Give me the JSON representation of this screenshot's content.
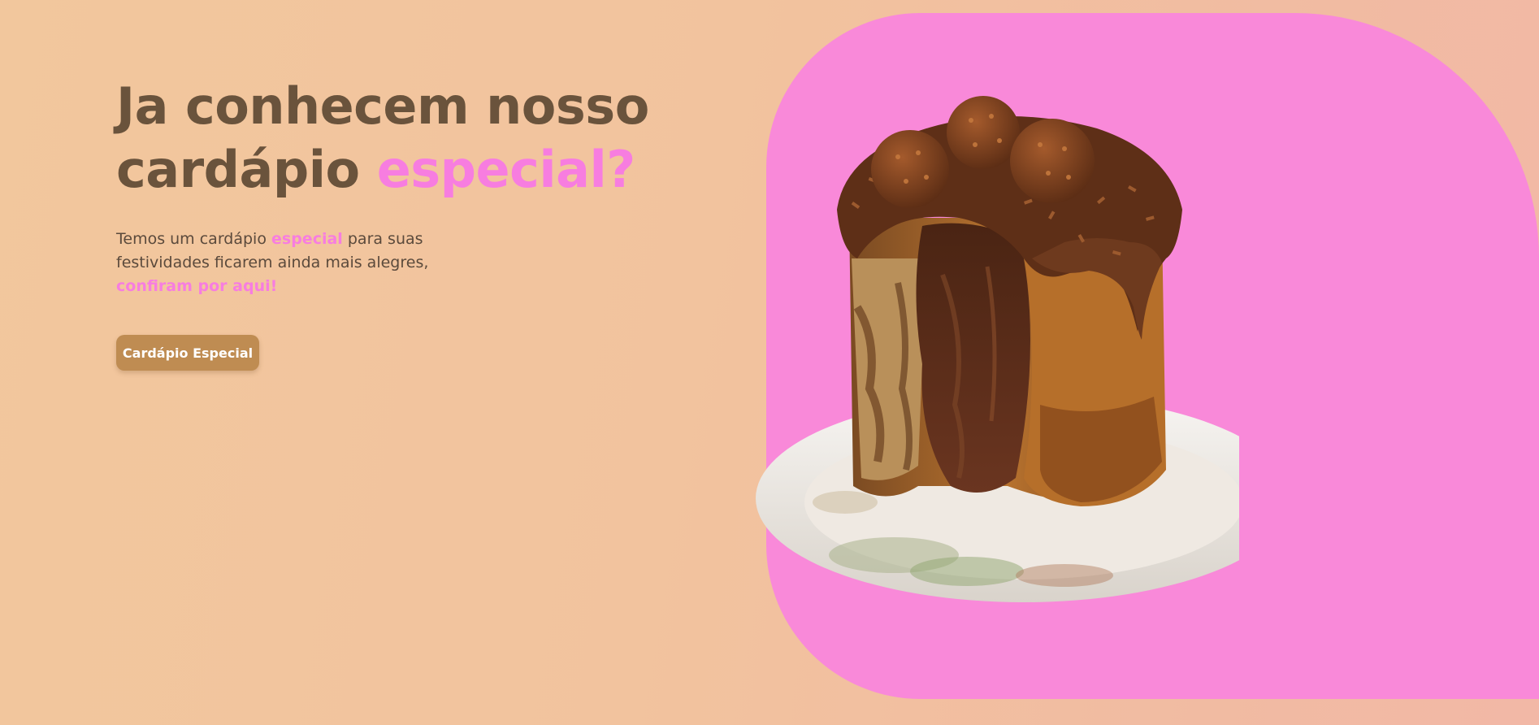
{
  "hero": {
    "headline_line1": "Ja conhecem nosso",
    "headline_line2_prefix": "cardápio",
    "headline_line2_accent": "especial?",
    "description_part1": "Temos um cardápio",
    "description_accent": "especial",
    "description_part2": "para suas festividades ficarem ainda mais alegres,",
    "description_cta": "confiram por aqui!",
    "button_label": "Cardápio Especial"
  },
  "image": {
    "subject": "chocolate-panettone-on-plate"
  },
  "colors": {
    "background": "#f2c49e",
    "headline": "#6a533c",
    "accent_pink": "#f77de0",
    "panel_pink": "#f989d9",
    "button": "#bf8c52",
    "button_text": "#ffffff"
  }
}
